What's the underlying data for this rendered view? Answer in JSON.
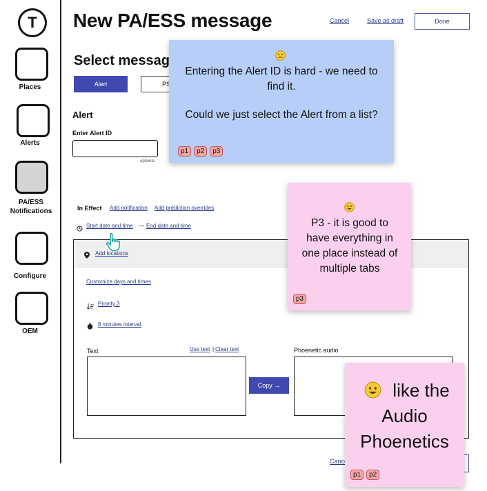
{
  "sidebar": {
    "logo_letter": "T",
    "items": [
      {
        "label": "Places"
      },
      {
        "label": "Alerts"
      },
      {
        "label": "PA/ESS Notifications"
      },
      {
        "label": "Configure"
      },
      {
        "label": "OEM"
      }
    ]
  },
  "header": {
    "title": "New PA/ESS message",
    "cancel_label": "Cancel",
    "save_draft_label": "Save as draft",
    "done_label": "Done"
  },
  "form": {
    "select_heading": "Select message",
    "type_alert_label": "Alert",
    "type_ps_label": "PS",
    "alert_heading": "Alert",
    "alert_id_label": "Enter Alert ID",
    "alert_id_value": "",
    "optional_label": "optional",
    "in_effect_label": "In Effect",
    "add_notification_label": "Add notification",
    "add_prediction_label": "Add prediction overrides",
    "start_date_label": "Start date and time",
    "dash": "—",
    "end_date_label": "End date and time",
    "add_locations_label": "Add locations",
    "customize_days_label": "Customize days and times",
    "priority_label": "Priority 3",
    "interval_label": "8 minutes interval",
    "text_label": "Text",
    "use_text_label": "Use text",
    "sep": "|",
    "clear_text_label": "Clear text",
    "text_value": "",
    "copy_label": "Copy",
    "copy_arrow": "→",
    "phonetic_label": "Phoenetic audio",
    "phonetic_value": "",
    "bottom_cancel_label": "Cance"
  },
  "notes": {
    "blue": {
      "emoji": "sad-face",
      "line1": "Entering the Alert ID is hard - we need to find it.",
      "line2": "Could we just select the Alert from a list?",
      "tags": [
        "p1",
        "p2",
        "p3"
      ]
    },
    "pink_p3": {
      "emoji": "smile-face",
      "text": "P3 - it is good to have everything in one place instead of multiple tabs",
      "tags": [
        "p3"
      ]
    },
    "pink_audio": {
      "emoji": "smile-face",
      "text": "like the Audio Phoenetics",
      "tags": [
        "p1",
        "p2"
      ]
    }
  },
  "colors": {
    "primary": "#3f49b0",
    "link": "#2a3a8c",
    "note_blue": "#b7cff8",
    "note_pink": "#fbd0ef",
    "tag": "#f3a6a6"
  }
}
